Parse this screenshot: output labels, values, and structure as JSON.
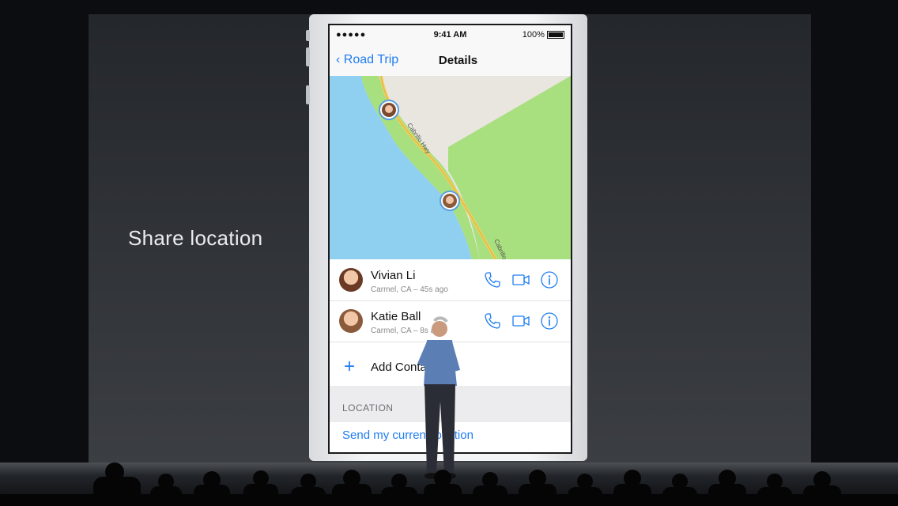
{
  "slide": {
    "caption": "Share location"
  },
  "status_bar": {
    "signal": "●●●●● ",
    "time": "9:41 AM",
    "battery": "100%"
  },
  "nav": {
    "back_label": "Road Trip",
    "title": "Details"
  },
  "map": {
    "road_labels": [
      "Cabrillo Hwy",
      "Cabrillo"
    ]
  },
  "contacts": [
    {
      "name": "Vivian Li",
      "subtitle": "Carmel, CA – 45s ago"
    },
    {
      "name": "Katie Ball",
      "subtitle": "Carmel, CA – 8s ago"
    }
  ],
  "add_contact": {
    "label": "Add Contact"
  },
  "location_section": {
    "header": "LOCATION",
    "action": "Send my current location"
  },
  "colors": {
    "accent": "#1e7cf2",
    "water": "#8fd0f0",
    "land": "#a8df7f",
    "road": "#f0d060"
  }
}
